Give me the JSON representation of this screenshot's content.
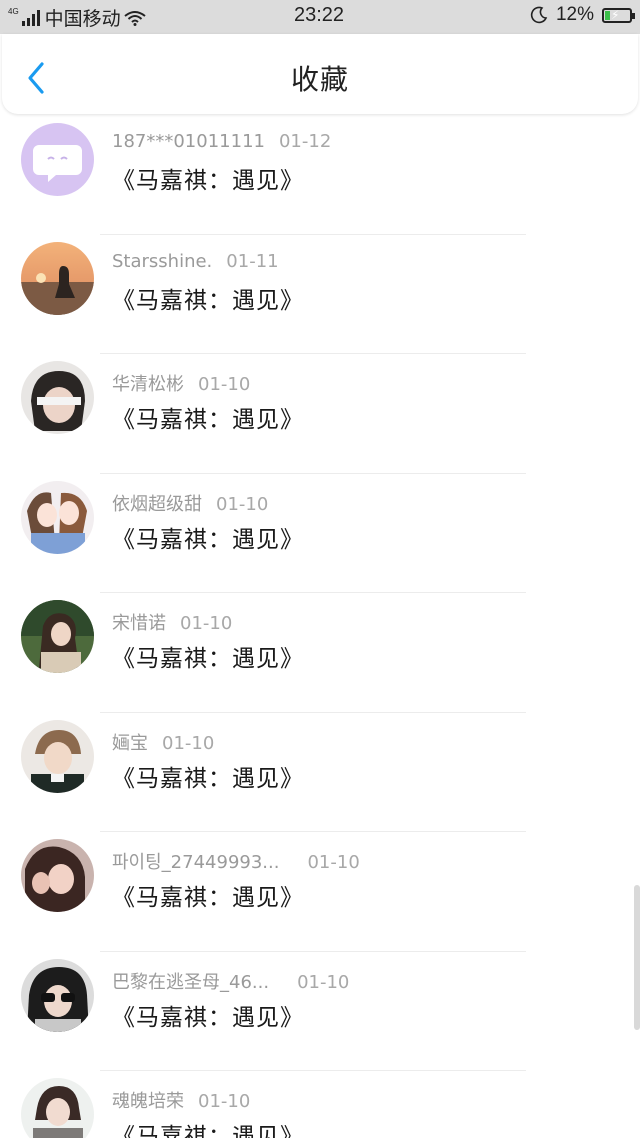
{
  "status_bar": {
    "network": "4G",
    "carrier": "中国移动",
    "time": "23:22",
    "battery": "12%"
  },
  "header": {
    "title": "收藏"
  },
  "items": [
    {
      "user": "187***01011111",
      "date": "01-12",
      "title": "《马嘉祺：遇见》"
    },
    {
      "user": "Starsshine.",
      "date": "01-11",
      "title": "《马嘉祺：遇见》"
    },
    {
      "user": "华清松彬",
      "date": "01-10",
      "title": "《马嘉祺：遇见》"
    },
    {
      "user": "依烟超级甜",
      "date": "01-10",
      "title": "《马嘉祺：遇见》"
    },
    {
      "user": "宋惜诺",
      "date": "01-10",
      "title": "《马嘉祺：遇见》"
    },
    {
      "user": "婳宝",
      "date": "01-10",
      "title": "《马嘉祺：遇见》"
    },
    {
      "user": "파이팅_27449993...",
      "date": "01-10",
      "title": "《马嘉祺：遇见》"
    },
    {
      "user": "巴黎在逃圣母_46...",
      "date": "01-10",
      "title": "《马嘉祺：遇见》"
    },
    {
      "user": "魂魄培荣",
      "date": "01-10",
      "title": "《马嘉祺：遇见》"
    }
  ]
}
